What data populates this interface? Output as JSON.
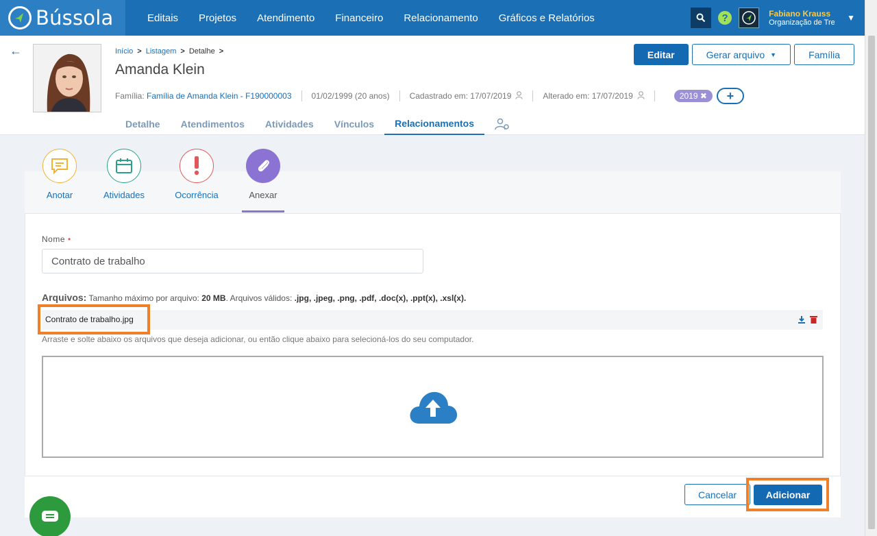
{
  "brand": {
    "name": "Bússola"
  },
  "nav": {
    "items": [
      "Editais",
      "Projetos",
      "Atendimento",
      "Financeiro",
      "Relacionamento",
      "Gráficos e Relatórios"
    ]
  },
  "user": {
    "name": "Fabiano Krauss",
    "org": "Organização de Tre"
  },
  "breadcrumb": {
    "home": "Início",
    "list": "Listagem",
    "current": "Detalhe",
    "sep": ">"
  },
  "person": {
    "name": "Amanda Klein",
    "family_label": "Família:",
    "family_value": "Família de Amanda Klein - F190000003",
    "birth": "01/02/1999 (20 anos)",
    "created": "Cadastrado em: 17/07/2019",
    "updated": "Alterado em: 17/07/2019",
    "tag": "2019"
  },
  "header_buttons": {
    "edit": "Editar",
    "generate": "Gerar arquivo",
    "family": "Família"
  },
  "tabs": [
    "Detalhe",
    "Atendimentos",
    "Atividades",
    "Vínculos",
    "Relacionamentos"
  ],
  "actions": [
    "Anotar",
    "Atividades",
    "Ocorrência",
    "Anexar"
  ],
  "form": {
    "name_label": "Nome",
    "name_required": "•",
    "name_value": "Contrato de trabalho",
    "files_label": "Arquivos:",
    "files_hint_1": "Tamanho máximo por arquivo:",
    "files_max": "20 MB",
    "files_hint_2": ". Arquivos válidos:",
    "files_types": ".jpg, .jpeg, .png, .pdf, .doc(x), .ppt(x), .xsl(x).",
    "file_name": "Contrato de trabalho.jpg",
    "drag_hint": "Arraste e solte abaixo os arquivos que deseja adicionar, ou então clique abaixo para selecioná-los do seu computador."
  },
  "footer": {
    "cancel": "Cancelar",
    "add": "Adicionar"
  },
  "colors": {
    "primary": "#136ab3",
    "highlight": "#f07f2a",
    "attach": "#8b73d3"
  }
}
